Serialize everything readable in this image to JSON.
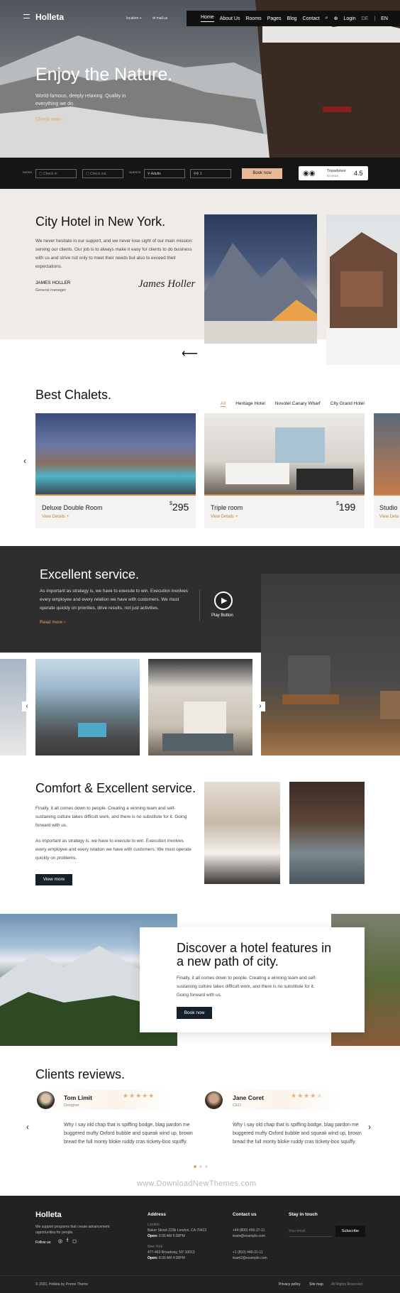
{
  "header": {
    "logo": "Holleta",
    "location": "location",
    "mail": "mail.us",
    "nav": [
      "Home",
      "About Us",
      "Rooms",
      "Pages",
      "Blog",
      "Contact"
    ],
    "login": "Login",
    "lang_de": "DE",
    "lang_sep": "|",
    "lang_en": "EN"
  },
  "hero": {
    "title": "Enjoy the Nature.",
    "subtitle": "World-famous, deeply relaxing. Quality in everything we do.",
    "cta": "Check now"
  },
  "booking": {
    "dates_label": "DATES",
    "guests_label": "GUESTS",
    "check_in": "Check in",
    "check_out": "Check out",
    "adults": "Adults",
    "kids": "1",
    "book": "Book now",
    "tripadvisor": "Tripadvisor",
    "reviews": "REVIEWS",
    "rating": "4.5"
  },
  "about": {
    "title": "City Hotel in New York.",
    "text": "We never hesitate in our support, and we never lose sight of our main mission: serving our clients. Our job is to always make it easy for clients to do business with us and strive not only to meet their needs but also to exceed their expectations.",
    "name": "JAMES HOLLER",
    "role": "General manager",
    "signature": "James Holler",
    "arrow": "⟵"
  },
  "chalets": {
    "title": "Best Chalets.",
    "tabs": [
      "All",
      "Heritage Hotel",
      "Novotel Canary Wharf",
      "City Grand Hotel"
    ],
    "cards": [
      {
        "name": "Deluxe Double Room",
        "currency": "$",
        "price": "295",
        "link": "View Details +"
      },
      {
        "name": "Triple room",
        "currency": "$",
        "price": "199",
        "link": "View Details +"
      },
      {
        "name": "Studio",
        "link": "View Deta"
      }
    ]
  },
  "service": {
    "title": "Excellent service.",
    "text": "As important as strategy is, we have to execute to win. Execution involves every employee and every relation we have with customers. We must operate quickly on priorities, drive results, not just activities.",
    "read_more": "Read more",
    "play": "Play Button"
  },
  "comfort": {
    "title": "Comfort & Excellent service.",
    "p1": "Finally, it all comes down to people. Creating a winning team and self-sustaining culture takes difficult work, and there is no substitute for it. Going forward with us.",
    "p2": "As important as strategy is, we have to execute to win. Execution involves every employee and every relation we have with customers. We must operate quickly on problems.",
    "button": "View more"
  },
  "discover": {
    "title": "Discover a hotel features in a new path of city.",
    "text": "Finally, it all comes down to people. Creating a winning team and self-sustaining culture takes difficult work, and there is no substitute for it. Going forward with us.",
    "button": "Book now"
  },
  "reviews": {
    "title": "Clients reviews.",
    "items": [
      {
        "name": "Tom Limit",
        "role": "Designer",
        "stars": 5,
        "text": "Why I say old chap that is spiffing bodge, blag pardon me buggered mufty Oxford bubble and squeak wind up, brown bread the full monty bloke ruddy cras tickety-boo squiffy."
      },
      {
        "name": "Jane Coret",
        "role": "CEO",
        "stars": 4,
        "text": "Why I say old chap that is spiffing bodge, blag pardon me buggered mufty Oxford bubble and squeak wind up, brown bread the full monty bloke ruddy cras tickety-boo squiffy."
      }
    ]
  },
  "watermark": "www.DownloadNewThemes.com",
  "footer": {
    "logo": "Holleta",
    "about": "We support programs that create advancement opportunities for people.",
    "follow": "Follow us:",
    "address_h": "Address",
    "london": "London",
    "london_addr": "Baker Street 223b London, CA 70413",
    "open_label": "Open:",
    "london_open": "9:30 AM 5:30PM",
    "ny": "New York",
    "ny_addr": "477-463 Broadway, NY 10013",
    "ny_open": "8:30 AM 4:30PM",
    "contact_h": "Contact us",
    "phone1": "+44 (800) 456-37-11",
    "email1": "team@example.com",
    "phone2": "+1 (810) 446-31-11",
    "email2": "team2@example.com",
    "stay_h": "Stay in touch",
    "email_ph": "Your email",
    "subscribe": "Subscribe",
    "copyright": "© 2020, Holleta by Promo Theme",
    "privacy": "Privacy policy",
    "sitemap": "Site map",
    "rights": "All Rights Reserved"
  }
}
